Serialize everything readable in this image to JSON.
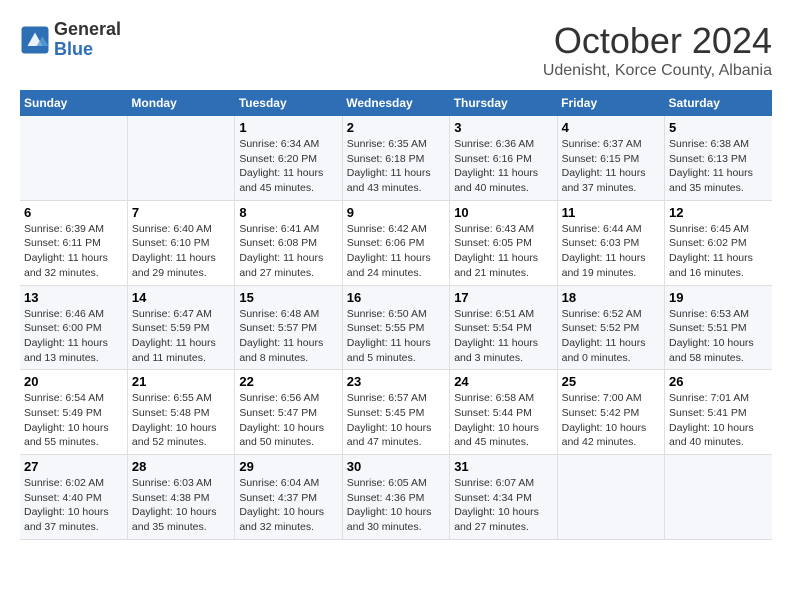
{
  "header": {
    "logo_general": "General",
    "logo_blue": "Blue",
    "month_title": "October 2024",
    "location": "Udenisht, Korce County, Albania"
  },
  "weekdays": [
    "Sunday",
    "Monday",
    "Tuesday",
    "Wednesday",
    "Thursday",
    "Friday",
    "Saturday"
  ],
  "weeks": [
    [
      {
        "day": "",
        "sunrise": "",
        "sunset": "",
        "daylight": ""
      },
      {
        "day": "",
        "sunrise": "",
        "sunset": "",
        "daylight": ""
      },
      {
        "day": "1",
        "sunrise": "Sunrise: 6:34 AM",
        "sunset": "Sunset: 6:20 PM",
        "daylight": "Daylight: 11 hours and 45 minutes."
      },
      {
        "day": "2",
        "sunrise": "Sunrise: 6:35 AM",
        "sunset": "Sunset: 6:18 PM",
        "daylight": "Daylight: 11 hours and 43 minutes."
      },
      {
        "day": "3",
        "sunrise": "Sunrise: 6:36 AM",
        "sunset": "Sunset: 6:16 PM",
        "daylight": "Daylight: 11 hours and 40 minutes."
      },
      {
        "day": "4",
        "sunrise": "Sunrise: 6:37 AM",
        "sunset": "Sunset: 6:15 PM",
        "daylight": "Daylight: 11 hours and 37 minutes."
      },
      {
        "day": "5",
        "sunrise": "Sunrise: 6:38 AM",
        "sunset": "Sunset: 6:13 PM",
        "daylight": "Daylight: 11 hours and 35 minutes."
      }
    ],
    [
      {
        "day": "6",
        "sunrise": "Sunrise: 6:39 AM",
        "sunset": "Sunset: 6:11 PM",
        "daylight": "Daylight: 11 hours and 32 minutes."
      },
      {
        "day": "7",
        "sunrise": "Sunrise: 6:40 AM",
        "sunset": "Sunset: 6:10 PM",
        "daylight": "Daylight: 11 hours and 29 minutes."
      },
      {
        "day": "8",
        "sunrise": "Sunrise: 6:41 AM",
        "sunset": "Sunset: 6:08 PM",
        "daylight": "Daylight: 11 hours and 27 minutes."
      },
      {
        "day": "9",
        "sunrise": "Sunrise: 6:42 AM",
        "sunset": "Sunset: 6:06 PM",
        "daylight": "Daylight: 11 hours and 24 minutes."
      },
      {
        "day": "10",
        "sunrise": "Sunrise: 6:43 AM",
        "sunset": "Sunset: 6:05 PM",
        "daylight": "Daylight: 11 hours and 21 minutes."
      },
      {
        "day": "11",
        "sunrise": "Sunrise: 6:44 AM",
        "sunset": "Sunset: 6:03 PM",
        "daylight": "Daylight: 11 hours and 19 minutes."
      },
      {
        "day": "12",
        "sunrise": "Sunrise: 6:45 AM",
        "sunset": "Sunset: 6:02 PM",
        "daylight": "Daylight: 11 hours and 16 minutes."
      }
    ],
    [
      {
        "day": "13",
        "sunrise": "Sunrise: 6:46 AM",
        "sunset": "Sunset: 6:00 PM",
        "daylight": "Daylight: 11 hours and 13 minutes."
      },
      {
        "day": "14",
        "sunrise": "Sunrise: 6:47 AM",
        "sunset": "Sunset: 5:59 PM",
        "daylight": "Daylight: 11 hours and 11 minutes."
      },
      {
        "day": "15",
        "sunrise": "Sunrise: 6:48 AM",
        "sunset": "Sunset: 5:57 PM",
        "daylight": "Daylight: 11 hours and 8 minutes."
      },
      {
        "day": "16",
        "sunrise": "Sunrise: 6:50 AM",
        "sunset": "Sunset: 5:55 PM",
        "daylight": "Daylight: 11 hours and 5 minutes."
      },
      {
        "day": "17",
        "sunrise": "Sunrise: 6:51 AM",
        "sunset": "Sunset: 5:54 PM",
        "daylight": "Daylight: 11 hours and 3 minutes."
      },
      {
        "day": "18",
        "sunrise": "Sunrise: 6:52 AM",
        "sunset": "Sunset: 5:52 PM",
        "daylight": "Daylight: 11 hours and 0 minutes."
      },
      {
        "day": "19",
        "sunrise": "Sunrise: 6:53 AM",
        "sunset": "Sunset: 5:51 PM",
        "daylight": "Daylight: 10 hours and 58 minutes."
      }
    ],
    [
      {
        "day": "20",
        "sunrise": "Sunrise: 6:54 AM",
        "sunset": "Sunset: 5:49 PM",
        "daylight": "Daylight: 10 hours and 55 minutes."
      },
      {
        "day": "21",
        "sunrise": "Sunrise: 6:55 AM",
        "sunset": "Sunset: 5:48 PM",
        "daylight": "Daylight: 10 hours and 52 minutes."
      },
      {
        "day": "22",
        "sunrise": "Sunrise: 6:56 AM",
        "sunset": "Sunset: 5:47 PM",
        "daylight": "Daylight: 10 hours and 50 minutes."
      },
      {
        "day": "23",
        "sunrise": "Sunrise: 6:57 AM",
        "sunset": "Sunset: 5:45 PM",
        "daylight": "Daylight: 10 hours and 47 minutes."
      },
      {
        "day": "24",
        "sunrise": "Sunrise: 6:58 AM",
        "sunset": "Sunset: 5:44 PM",
        "daylight": "Daylight: 10 hours and 45 minutes."
      },
      {
        "day": "25",
        "sunrise": "Sunrise: 7:00 AM",
        "sunset": "Sunset: 5:42 PM",
        "daylight": "Daylight: 10 hours and 42 minutes."
      },
      {
        "day": "26",
        "sunrise": "Sunrise: 7:01 AM",
        "sunset": "Sunset: 5:41 PM",
        "daylight": "Daylight: 10 hours and 40 minutes."
      }
    ],
    [
      {
        "day": "27",
        "sunrise": "Sunrise: 6:02 AM",
        "sunset": "Sunset: 4:40 PM",
        "daylight": "Daylight: 10 hours and 37 minutes."
      },
      {
        "day": "28",
        "sunrise": "Sunrise: 6:03 AM",
        "sunset": "Sunset: 4:38 PM",
        "daylight": "Daylight: 10 hours and 35 minutes."
      },
      {
        "day": "29",
        "sunrise": "Sunrise: 6:04 AM",
        "sunset": "Sunset: 4:37 PM",
        "daylight": "Daylight: 10 hours and 32 minutes."
      },
      {
        "day": "30",
        "sunrise": "Sunrise: 6:05 AM",
        "sunset": "Sunset: 4:36 PM",
        "daylight": "Daylight: 10 hours and 30 minutes."
      },
      {
        "day": "31",
        "sunrise": "Sunrise: 6:07 AM",
        "sunset": "Sunset: 4:34 PM",
        "daylight": "Daylight: 10 hours and 27 minutes."
      },
      {
        "day": "",
        "sunrise": "",
        "sunset": "",
        "daylight": ""
      },
      {
        "day": "",
        "sunrise": "",
        "sunset": "",
        "daylight": ""
      }
    ]
  ]
}
